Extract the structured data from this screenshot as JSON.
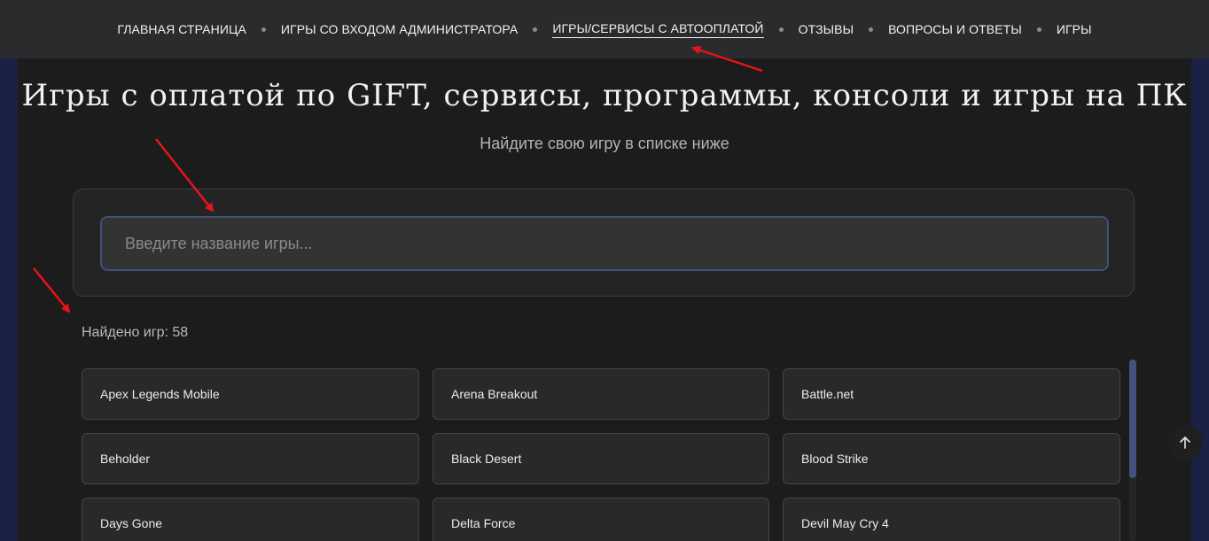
{
  "nav": {
    "items": [
      {
        "label": "ГЛАВНАЯ СТРАНИЦА",
        "active": false
      },
      {
        "label": "ИГРЫ СО ВХОДОМ АДМИНИСТРАТОРА",
        "active": false
      },
      {
        "label": "ИГРЫ/СЕРВИСЫ С АВТООПЛАТОЙ",
        "active": true
      },
      {
        "label": "ОТЗЫВЫ",
        "active": false
      },
      {
        "label": "ВОПРОСЫ И ОТВЕТЫ",
        "active": false
      },
      {
        "label": "ИГРЫ",
        "active": false
      }
    ]
  },
  "main": {
    "title": "Игры с оплатой по GIFT, сервисы, программы, консоли и игры на ПК",
    "subtitle": "Найдите свою игру в списке ниже"
  },
  "search": {
    "placeholder": "Введите название игры...",
    "value": ""
  },
  "results": {
    "count_label": "Найдено игр: 58"
  },
  "games": [
    "Apex Legends Mobile",
    "Arena Breakout",
    "Battle.net",
    "Beholder",
    "Black Desert",
    "Blood Strike",
    "Days Gone",
    "Delta Force",
    "Devil May Cry 4"
  ],
  "icons": {
    "scroll_top": "arrow-up-icon",
    "annotation": "red-arrow-icon"
  },
  "colors": {
    "background": "#1d2447",
    "topbar": "#2a2b2d",
    "panel": "#1c1c1d",
    "accent": "#44527e",
    "annotation": "#e8141a"
  }
}
